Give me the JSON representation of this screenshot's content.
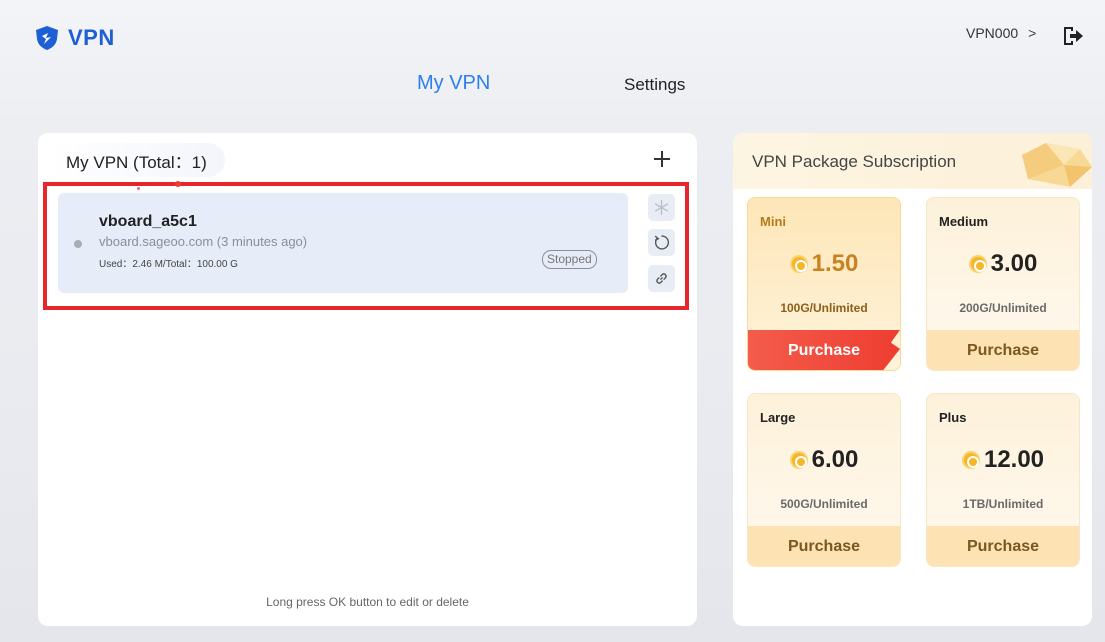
{
  "header": {
    "logo_text": "VPN",
    "user": "VPN000",
    "user_chevron": ">"
  },
  "nav": {
    "tabs": [
      {
        "label": "My VPN",
        "active": true
      },
      {
        "label": "Settings",
        "active": false
      }
    ]
  },
  "vpn_list": {
    "title": "My VPN (Total：1)",
    "items": [
      {
        "name": "vboard_a5c1",
        "host": "vboard.sageoo.com  (3 minutes ago)",
        "usage": "Used：2.46 M/Total：100.00 G",
        "status": "Stopped"
      }
    ],
    "hint": "Long press OK button to edit or delete"
  },
  "subscription": {
    "title": "VPN Package Subscription",
    "packages": [
      {
        "name": "Mini",
        "price": "1.50",
        "quota": "100G/Unlimited",
        "button": "Purchase",
        "active": true
      },
      {
        "name": "Medium",
        "price": "3.00",
        "quota": "200G/Unlimited",
        "button": "Purchase",
        "active": false
      },
      {
        "name": "Large",
        "price": "6.00",
        "quota": "500G/Unlimited",
        "button": "Purchase",
        "active": false
      },
      {
        "name": "Plus",
        "price": "12.00",
        "quota": "1TB/Unlimited",
        "button": "Purchase",
        "active": false
      }
    ]
  },
  "colors": {
    "accent_blue": "#2b7ff0",
    "highlight_red": "#e5262b",
    "purchase_active": "#ee3d31",
    "purchase_default": "#fde3b4"
  }
}
